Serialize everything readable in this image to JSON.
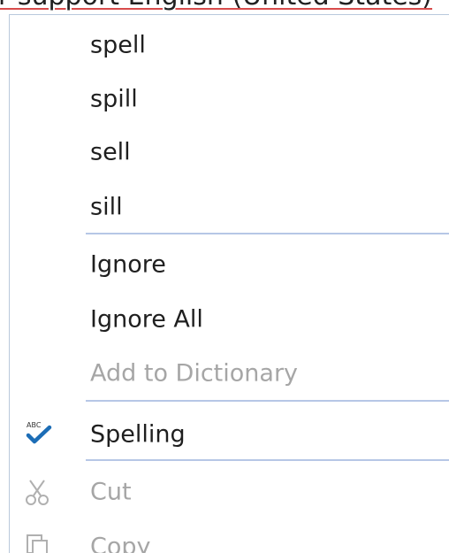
{
  "background_text": "r support English (United States)",
  "menu": {
    "suggestions": [
      "spell",
      "spill",
      "sell",
      "sill"
    ],
    "ignore": "Ignore",
    "ignore_all": "Ignore All",
    "add_to_dictionary": "Add to Dictionary",
    "spelling": "Spelling",
    "cut": "Cut",
    "copy": "Copy"
  },
  "icons": {
    "spelling": "abc-spellcheck-icon",
    "cut": "scissors-icon",
    "copy": "copy-icon"
  },
  "colors": {
    "menu_border": "#b9c9dc",
    "separator": "#b6c7e6",
    "text": "#1f1f1f",
    "disabled_text": "#a6a6a6",
    "spellcheck_accent": "#1c6db6"
  }
}
